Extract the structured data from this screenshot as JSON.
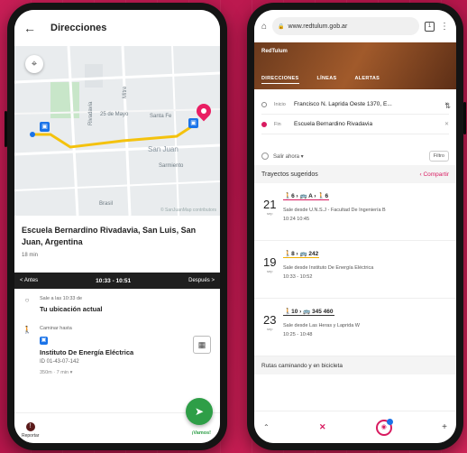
{
  "left_app": {
    "title": "Direcciones",
    "map": {
      "labels": [
        "25 de Mayo",
        "Santa Fe",
        "San Juan",
        "Rivadavia",
        "Sarmiento",
        "Mitre",
        "Brasil"
      ],
      "copyright": "© SanJuanMap contributors"
    },
    "destination": {
      "name": "Escuela Bernardino Rivadavia, San Luis, San Juan, Argentina",
      "duration": "18 min"
    },
    "nav": {
      "prev": "< Antes",
      "time_range": "10:33 - 10:51",
      "next": "Después >"
    },
    "steps": {
      "start_time": "Sale a las 10:33 de",
      "start_place": "Tu ubicación actual",
      "walk_label": "Caminar hasta",
      "stop_name": "Instituto De Energía Eléctrica",
      "stop_id": "ID 01-43-07-142",
      "walk_meta": "350m · 7 min ▾"
    },
    "bottom": {
      "report_label": "Reportar",
      "go_label": "¡Vamos!"
    }
  },
  "right_app": {
    "url": "www.redtulum.gob.ar",
    "brand": "RedTulum",
    "menu": [
      "DIRECCIONES",
      "LÍNEAS",
      "ALERTAS"
    ],
    "from_label": "Inicio",
    "from_value": "Francisco N. Laprida Oeste 1370, E...",
    "to_label": "Fin",
    "to_value": "Escuela Bernardino Rivadavia",
    "depart_option": "Salir ahora ▾",
    "filter_label": "Filtro",
    "suggested_title": "Trayectos sugeridos",
    "share_label": "Compartir",
    "trips": [
      {
        "day": "21",
        "month": "sep",
        "legs": "🚶6 › 🚌 A › 🚶6",
        "desc": "Sale desde U.N.S.J - Facultad De Ingeniería B",
        "time": "10:24  10:45"
      },
      {
        "day": "19",
        "month": "sep",
        "legs": "🚶8 › 🚌 242",
        "desc": "Sale desde Instituto De Energía Eléctrica",
        "time": "10:33 - 10:52"
      },
      {
        "day": "23",
        "month": "sep",
        "legs": "🚶10 › 🚌 345  460",
        "desc": "Sale desde Las Heras y Laprida W",
        "time": "10:25 - 10:48"
      }
    ],
    "bike_label": "Rutas caminando y en bicicleta"
  }
}
